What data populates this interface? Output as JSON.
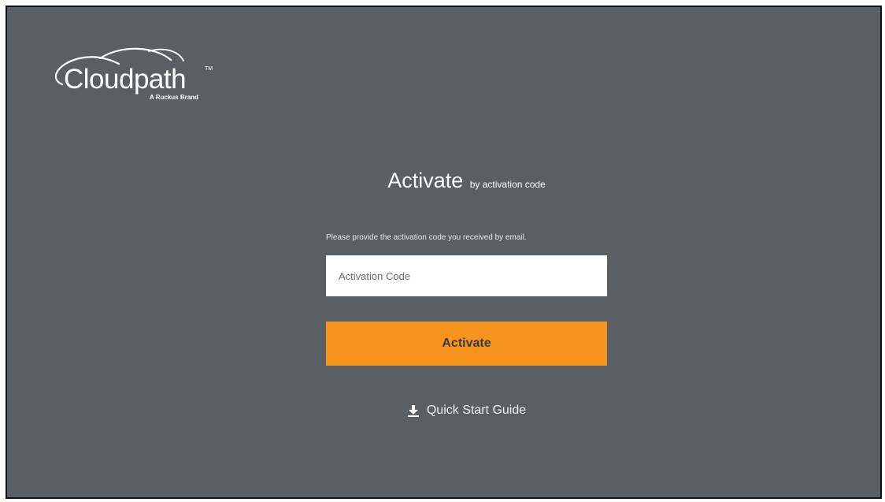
{
  "brand": {
    "logo_text": "Cloudpath",
    "trademark": "TM",
    "tagline": "A Ruckus Brand",
    "logo_icon": "cloud-swoosh-icon"
  },
  "activation": {
    "title": "Activate",
    "subtitle": "by activation code",
    "instructions": "Please provide the activation code you received by email.",
    "code_input": {
      "value": "",
      "placeholder": "Activation Code"
    },
    "submit_label": "Activate"
  },
  "guide": {
    "icon": "download-icon",
    "label": "Quick Start Guide"
  },
  "colors": {
    "background": "#5a5f66",
    "accent": "#f7941d",
    "text": "#ffffff"
  }
}
